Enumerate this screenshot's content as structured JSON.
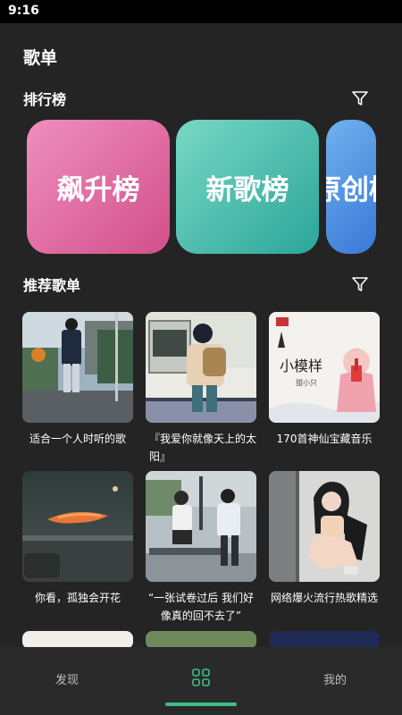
{
  "status_bar": {
    "time": "9:16"
  },
  "page": {
    "title": "歌单"
  },
  "ranking": {
    "title": "排行榜",
    "cards": [
      {
        "label": "飙升榜"
      },
      {
        "label": "新歌榜"
      },
      {
        "label": "原创榜"
      }
    ]
  },
  "recommend": {
    "title": "推荐歌单",
    "playlists": [
      {
        "title": "适合一个人时听的歌"
      },
      {
        "title": "『我爱你就像天上的太阳』"
      },
      {
        "title": "170首神仙宝藏音乐"
      },
      {
        "title": "你看，孤独会开花"
      },
      {
        "title": "“一张试卷过后 我们好像真的回不去了”"
      },
      {
        "title": "网络爆火流行热歌精选"
      }
    ]
  },
  "bottom_nav": {
    "items": [
      {
        "label": "发现"
      },
      {
        "label": ""
      },
      {
        "label": "我的"
      }
    ],
    "active_color": "#3fbf86"
  },
  "icons": {
    "ranking_filter": "filter-icon",
    "recommend_filter": "filter-icon",
    "nav_center": "grid-icon"
  }
}
